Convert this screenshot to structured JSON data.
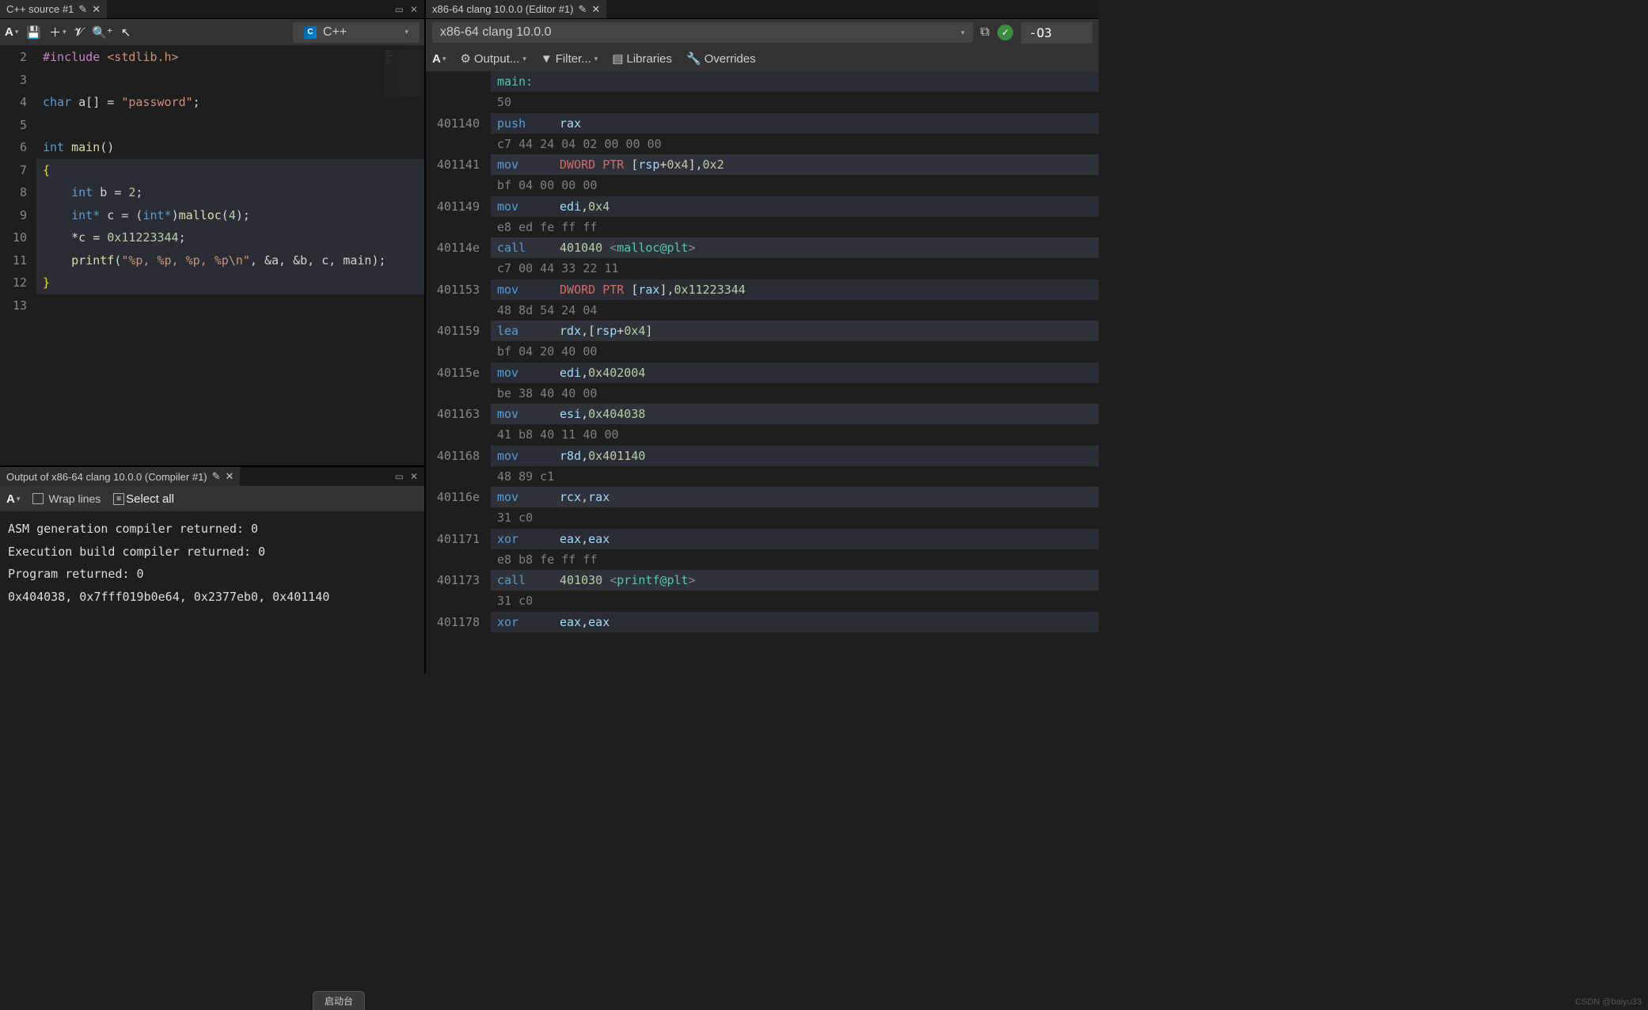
{
  "source_tab": {
    "title": "C++ source #1"
  },
  "compiler_tab": {
    "title": "x86-64 clang 10.0.0 (Editor #1)"
  },
  "output_tab": {
    "title": "Output of x86-64 clang 10.0.0 (Compiler #1)"
  },
  "language": "C++",
  "compiler_name": "x86-64 clang 10.0.0",
  "compiler_flags": "-O3",
  "toolbar": {
    "output_label": "Output...",
    "filter_label": "Filter...",
    "libraries_label": "Libraries",
    "overrides_label": "Overrides",
    "wrap_label": "Wrap lines",
    "selectall_label": "Select all"
  },
  "code": {
    "lines": [
      {
        "n": 2,
        "html": "<span class='inc'>#include</span> <span class='str'>&lt;stdlib.h&gt;</span>"
      },
      {
        "n": 3,
        "html": ""
      },
      {
        "n": 4,
        "html": "<span class='type'>char</span> <span class='id'>a[]</span> <span class='pun'>=</span> <span class='str'>\"password\"</span><span class='pun'>;</span>"
      },
      {
        "n": 5,
        "html": ""
      },
      {
        "n": 6,
        "html": "<span class='type'>int</span> <span class='fn'>main</span><span class='pun'>()</span>"
      },
      {
        "n": 7,
        "html": "<span class='brace'>{</span>",
        "hl": true
      },
      {
        "n": 8,
        "html": "    <span class='type'>int</span> <span class='id'>b</span> <span class='pun'>=</span> <span class='num'>2</span><span class='pun'>;</span>",
        "hl": true
      },
      {
        "n": 9,
        "html": "    <span class='type'>int*</span> <span class='id'>c</span> <span class='pun'>=</span> <span class='pun'>(</span><span class='type'>int*</span><span class='pun'>)</span><span class='fn'>malloc</span><span class='pun'>(</span><span class='num'>4</span><span class='pun'>);</span>",
        "hl": true
      },
      {
        "n": 10,
        "html": "    <span class='pun'>*</span><span class='id'>c</span> <span class='pun'>=</span> <span class='num'>0x11223344</span><span class='pun'>;</span>",
        "hl": true
      },
      {
        "n": 11,
        "html": "    <span class='fn'>printf</span><span class='pun'>(</span><span class='str'>\"%p, %p, %p, %p\\n\"</span><span class='pun'>,</span> <span class='pun'>&amp;</span><span class='id'>a</span><span class='pun'>,</span> <span class='pun'>&amp;</span><span class='id'>b</span><span class='pun'>,</span> <span class='id'>c</span><span class='pun'>,</span> <span class='id'>main</span><span class='pun'>);</span>",
        "hl": true
      },
      {
        "n": 12,
        "html": "<span class='brace'>}</span>",
        "hl": true
      },
      {
        "n": 13,
        "html": ""
      }
    ]
  },
  "output_lines": [
    "ASM generation compiler returned: 0",
    "Execution build compiler returned: 0",
    "Program returned: 0",
    " 0x404038, 0x7fff019b0e64, 0x2377eb0, 0x401140"
  ],
  "asm": [
    {
      "type": "label",
      "text": "main:"
    },
    {
      "type": "bytes",
      "text": "50"
    },
    {
      "addr": "401140",
      "html": "<span class='op'>push</span> <span class='reg'>rax</span>"
    },
    {
      "type": "bytes",
      "text": "c7 44 24 04 02 00 00 00"
    },
    {
      "addr": "401141",
      "html": "<span class='op'>mov</span> <span class='dptr'>DWORD PTR</span> <span class='pun'>[</span><span class='reg'>rsp</span><span class='pun'>+</span><span class='hex'>0x4</span><span class='pun'>],</span><span class='hex'>0x2</span>"
    },
    {
      "type": "bytes",
      "text": "bf 04 00 00 00"
    },
    {
      "addr": "401149",
      "html": "<span class='op'>mov</span> <span class='reg'>edi</span><span class='pun'>,</span><span class='hex'>0x4</span>"
    },
    {
      "type": "bytes",
      "text": "e8 ed fe ff ff"
    },
    {
      "addr": "40114e",
      "html": "<span class='op'>call</span> <span class='hex'>401040</span> <span class='sym'>&lt;</span><span class='call-target'>malloc@plt</span><span class='sym'>&gt;</span>"
    },
    {
      "type": "bytes",
      "text": "c7 00 44 33 22 11"
    },
    {
      "addr": "401153",
      "html": "<span class='op'>mov</span> <span class='dptr'>DWORD PTR</span> <span class='pun'>[</span><span class='reg'>rax</span><span class='pun'>],</span><span class='hex'>0x11223344</span>"
    },
    {
      "type": "bytes",
      "text": "48 8d 54 24 04"
    },
    {
      "addr": "401159",
      "html": "<span class='op'>lea</span> <span class='reg'>rdx</span><span class='pun'>,[</span><span class='reg'>rsp</span><span class='pun'>+</span><span class='hex'>0x4</span><span class='pun'>]</span>"
    },
    {
      "type": "bytes",
      "text": "bf 04 20 40 00"
    },
    {
      "addr": "40115e",
      "html": "<span class='op'>mov</span> <span class='reg'>edi</span><span class='pun'>,</span><span class='hex'>0x402004</span>"
    },
    {
      "type": "bytes",
      "text": "be 38 40 40 00"
    },
    {
      "addr": "401163",
      "html": "<span class='op'>mov</span> <span class='reg'>esi</span><span class='pun'>,</span><span class='hex'>0x404038</span>"
    },
    {
      "type": "bytes",
      "text": "41 b8 40 11 40 00"
    },
    {
      "addr": "401168",
      "html": "<span class='op'>mov</span> <span class='reg'>r8d</span><span class='pun'>,</span><span class='hex'>0x401140</span>"
    },
    {
      "type": "bytes",
      "text": "48 89 c1"
    },
    {
      "addr": "40116e",
      "html": "<span class='op'>mov</span> <span class='reg'>rcx</span><span class='pun'>,</span><span class='reg'>rax</span>"
    },
    {
      "type": "bytes",
      "text": "31 c0"
    },
    {
      "addr": "401171",
      "html": "<span class='op'>xor</span> <span class='reg'>eax</span><span class='pun'>,</span><span class='reg'>eax</span>"
    },
    {
      "type": "bytes",
      "text": "e8 b8 fe ff ff"
    },
    {
      "addr": "401173",
      "html": "<span class='op'>call</span> <span class='hex'>401030</span> <span class='sym'>&lt;</span><span class='call-target'>printf@plt</span><span class='sym'>&gt;</span>"
    },
    {
      "type": "bytes",
      "text": "31 c0"
    },
    {
      "addr": "401178",
      "html": "<span class='op'>xor</span> <span class='reg'>eax</span><span class='pun'>,</span><span class='reg'>eax</span>"
    }
  ],
  "watermark": "CSDN @baiyu33",
  "footer_btn": "启动台"
}
